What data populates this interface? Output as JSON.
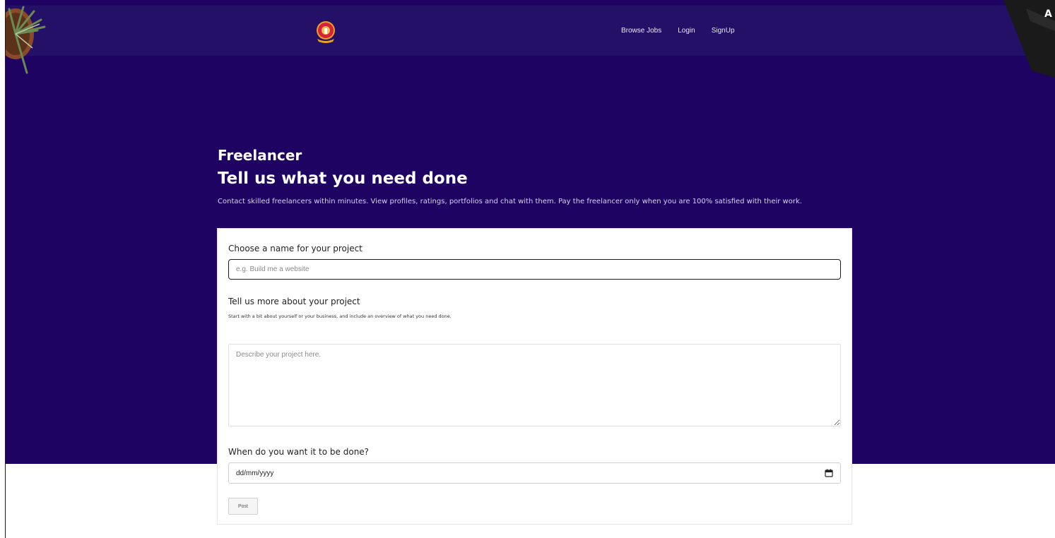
{
  "nav": {
    "logo_icon": "lamp-emblem-icon",
    "links": [
      "Browse Jobs",
      "Login",
      "SignUp"
    ]
  },
  "hero": {
    "title": "Freelancer",
    "headline": "Tell us what you need done",
    "subtitle": "Contact skilled freelancers within minutes. View profiles, ratings, portfolios and chat with them. Pay the freelancer only when you are 100% satisfied with their work."
  },
  "form": {
    "name_label": "Choose a name for your project",
    "name_placeholder": "e.g. Build me a website",
    "description_label": "Tell us more about your project",
    "description_help": "Start with a bit about yourself or your business, and include an overview of what you need done.",
    "description_placeholder": "Describe your project here.",
    "date_label": "When do you want it to be done?",
    "date_value": "dd/mm/yyyy",
    "post_label": "Post"
  },
  "colors": {
    "hero_bg": "#1e0362",
    "nav_bg": "#241066",
    "card_bg": "#ffffff"
  }
}
